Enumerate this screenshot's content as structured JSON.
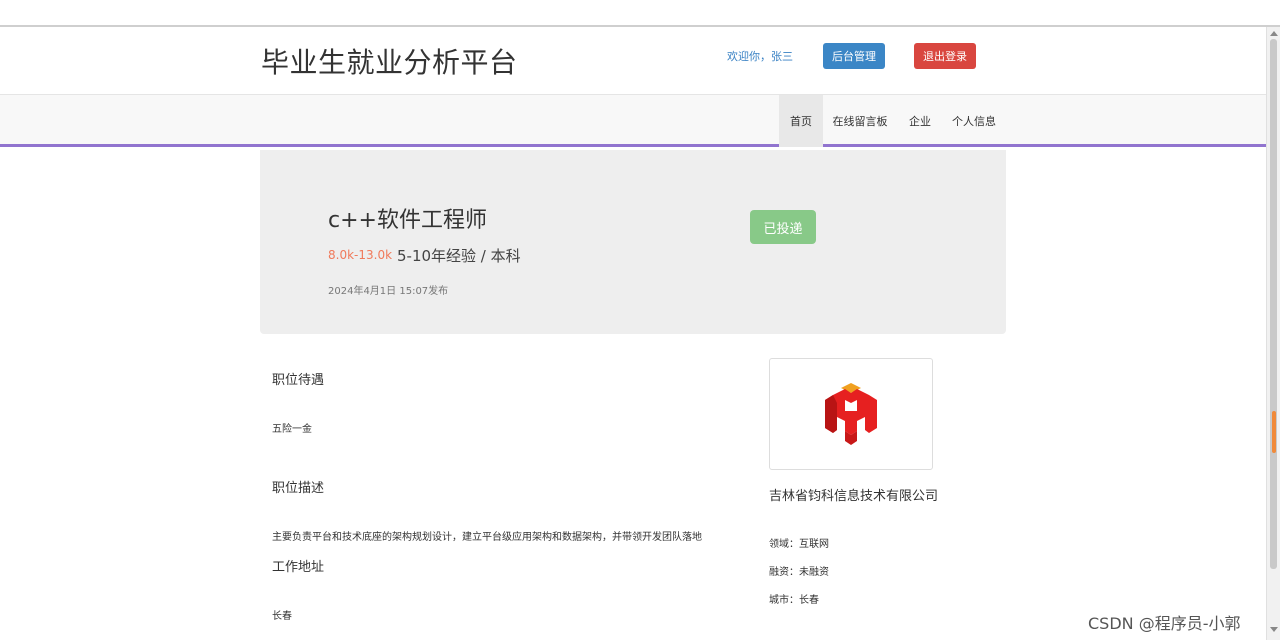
{
  "header": {
    "title": "毕业生就业分析平台",
    "welcome": "欢迎你，张三",
    "admin_label": "后台管理",
    "logout_label": "退出登录"
  },
  "nav": {
    "items": [
      {
        "label": "首页"
      },
      {
        "label": "在线留言板"
      },
      {
        "label": "企业"
      },
      {
        "label": "个人信息"
      }
    ]
  },
  "job": {
    "title": "c++软件工程师",
    "salary": "8.0k-13.0k",
    "requirements": "5-10年经验 / 本科",
    "posted": "2024年4月1日 15:07发布",
    "status_label": "已投递"
  },
  "details": {
    "benefits_heading": "职位待遇",
    "benefits_text": "五险一金",
    "description_heading": "职位描述",
    "description_text": "主要负责平台和技术底座的架构规划设计，建立平台级应用架构和数据架构，并带领开发团队落地",
    "address_heading": "工作地址",
    "address_text": "长春"
  },
  "company": {
    "logo_icon": "company-logo",
    "name": "吉林省钧科信息技术有限公司",
    "field_label": "领域：",
    "field_value": "互联网",
    "funding_label": "融资：",
    "funding_value": "未融资",
    "city_label": "城市：",
    "city_value": "长春"
  },
  "colors": {
    "accent_purple": "#9174cf",
    "admin_blue": "#3b86c6",
    "logout_red": "#d9463f",
    "applied_green": "#88c988",
    "salary_orange": "#f07a5b"
  },
  "watermark": "CSDN @程序员-小郭"
}
